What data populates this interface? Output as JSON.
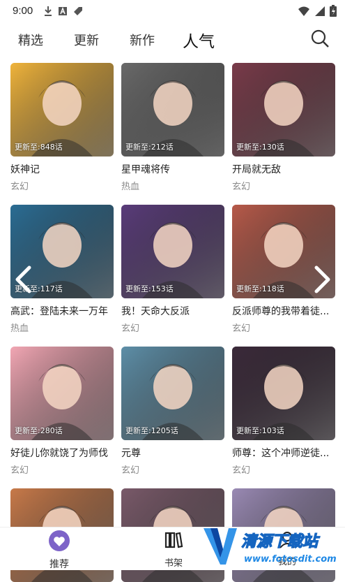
{
  "status": {
    "time": "9:00"
  },
  "tabs": [
    {
      "label": "精选"
    },
    {
      "label": "更新"
    },
    {
      "label": "新作"
    },
    {
      "label": "人气"
    }
  ],
  "cards": [
    {
      "update": "更新至:848话",
      "title": "妖神记",
      "genre": "玄幻",
      "color": "#f0b43c"
    },
    {
      "update": "更新至:212话",
      "title": "星甲魂将传",
      "genre": "热血",
      "color": "#6a6a6a"
    },
    {
      "update": "更新至:130话",
      "title": "开局就无敌",
      "genre": "玄幻",
      "color": "#7a3b4a"
    },
    {
      "update": "更新至:117话",
      "title": "高武：登陆未来一万年",
      "genre": "热血",
      "color": "#2b6d94"
    },
    {
      "update": "更新至:153话",
      "title": "我！天命大反派",
      "genre": "玄幻",
      "color": "#5a3c7a"
    },
    {
      "update": "更新至:118话",
      "title": "反派师尊的我带着徒...",
      "genre": "玄幻",
      "color": "#b75a4a"
    },
    {
      "update": "更新至:280话",
      "title": "好徒儿你就饶了为师伐",
      "genre": "玄幻",
      "color": "#f2a7b4"
    },
    {
      "update": "更新至:1205话",
      "title": "元尊",
      "genre": "玄幻",
      "color": "#5e8fa8"
    },
    {
      "update": "更新至:103话",
      "title": "师尊：这个冲师逆徒...",
      "genre": "玄幻",
      "color": "#3b2a3a"
    },
    {
      "update": "",
      "title": "",
      "genre": "",
      "color": "#c87a4a"
    },
    {
      "update": "",
      "title": "",
      "genre": "",
      "color": "#7a5a6a"
    },
    {
      "update": "",
      "title": "",
      "genre": "",
      "color": "#9a8ab4"
    }
  ],
  "nav": {
    "recommend": "推荐",
    "bookshelf": "书架",
    "mine": "我的"
  },
  "watermark": {
    "name": "清源下载站",
    "url": "www.fotosdit.com"
  }
}
